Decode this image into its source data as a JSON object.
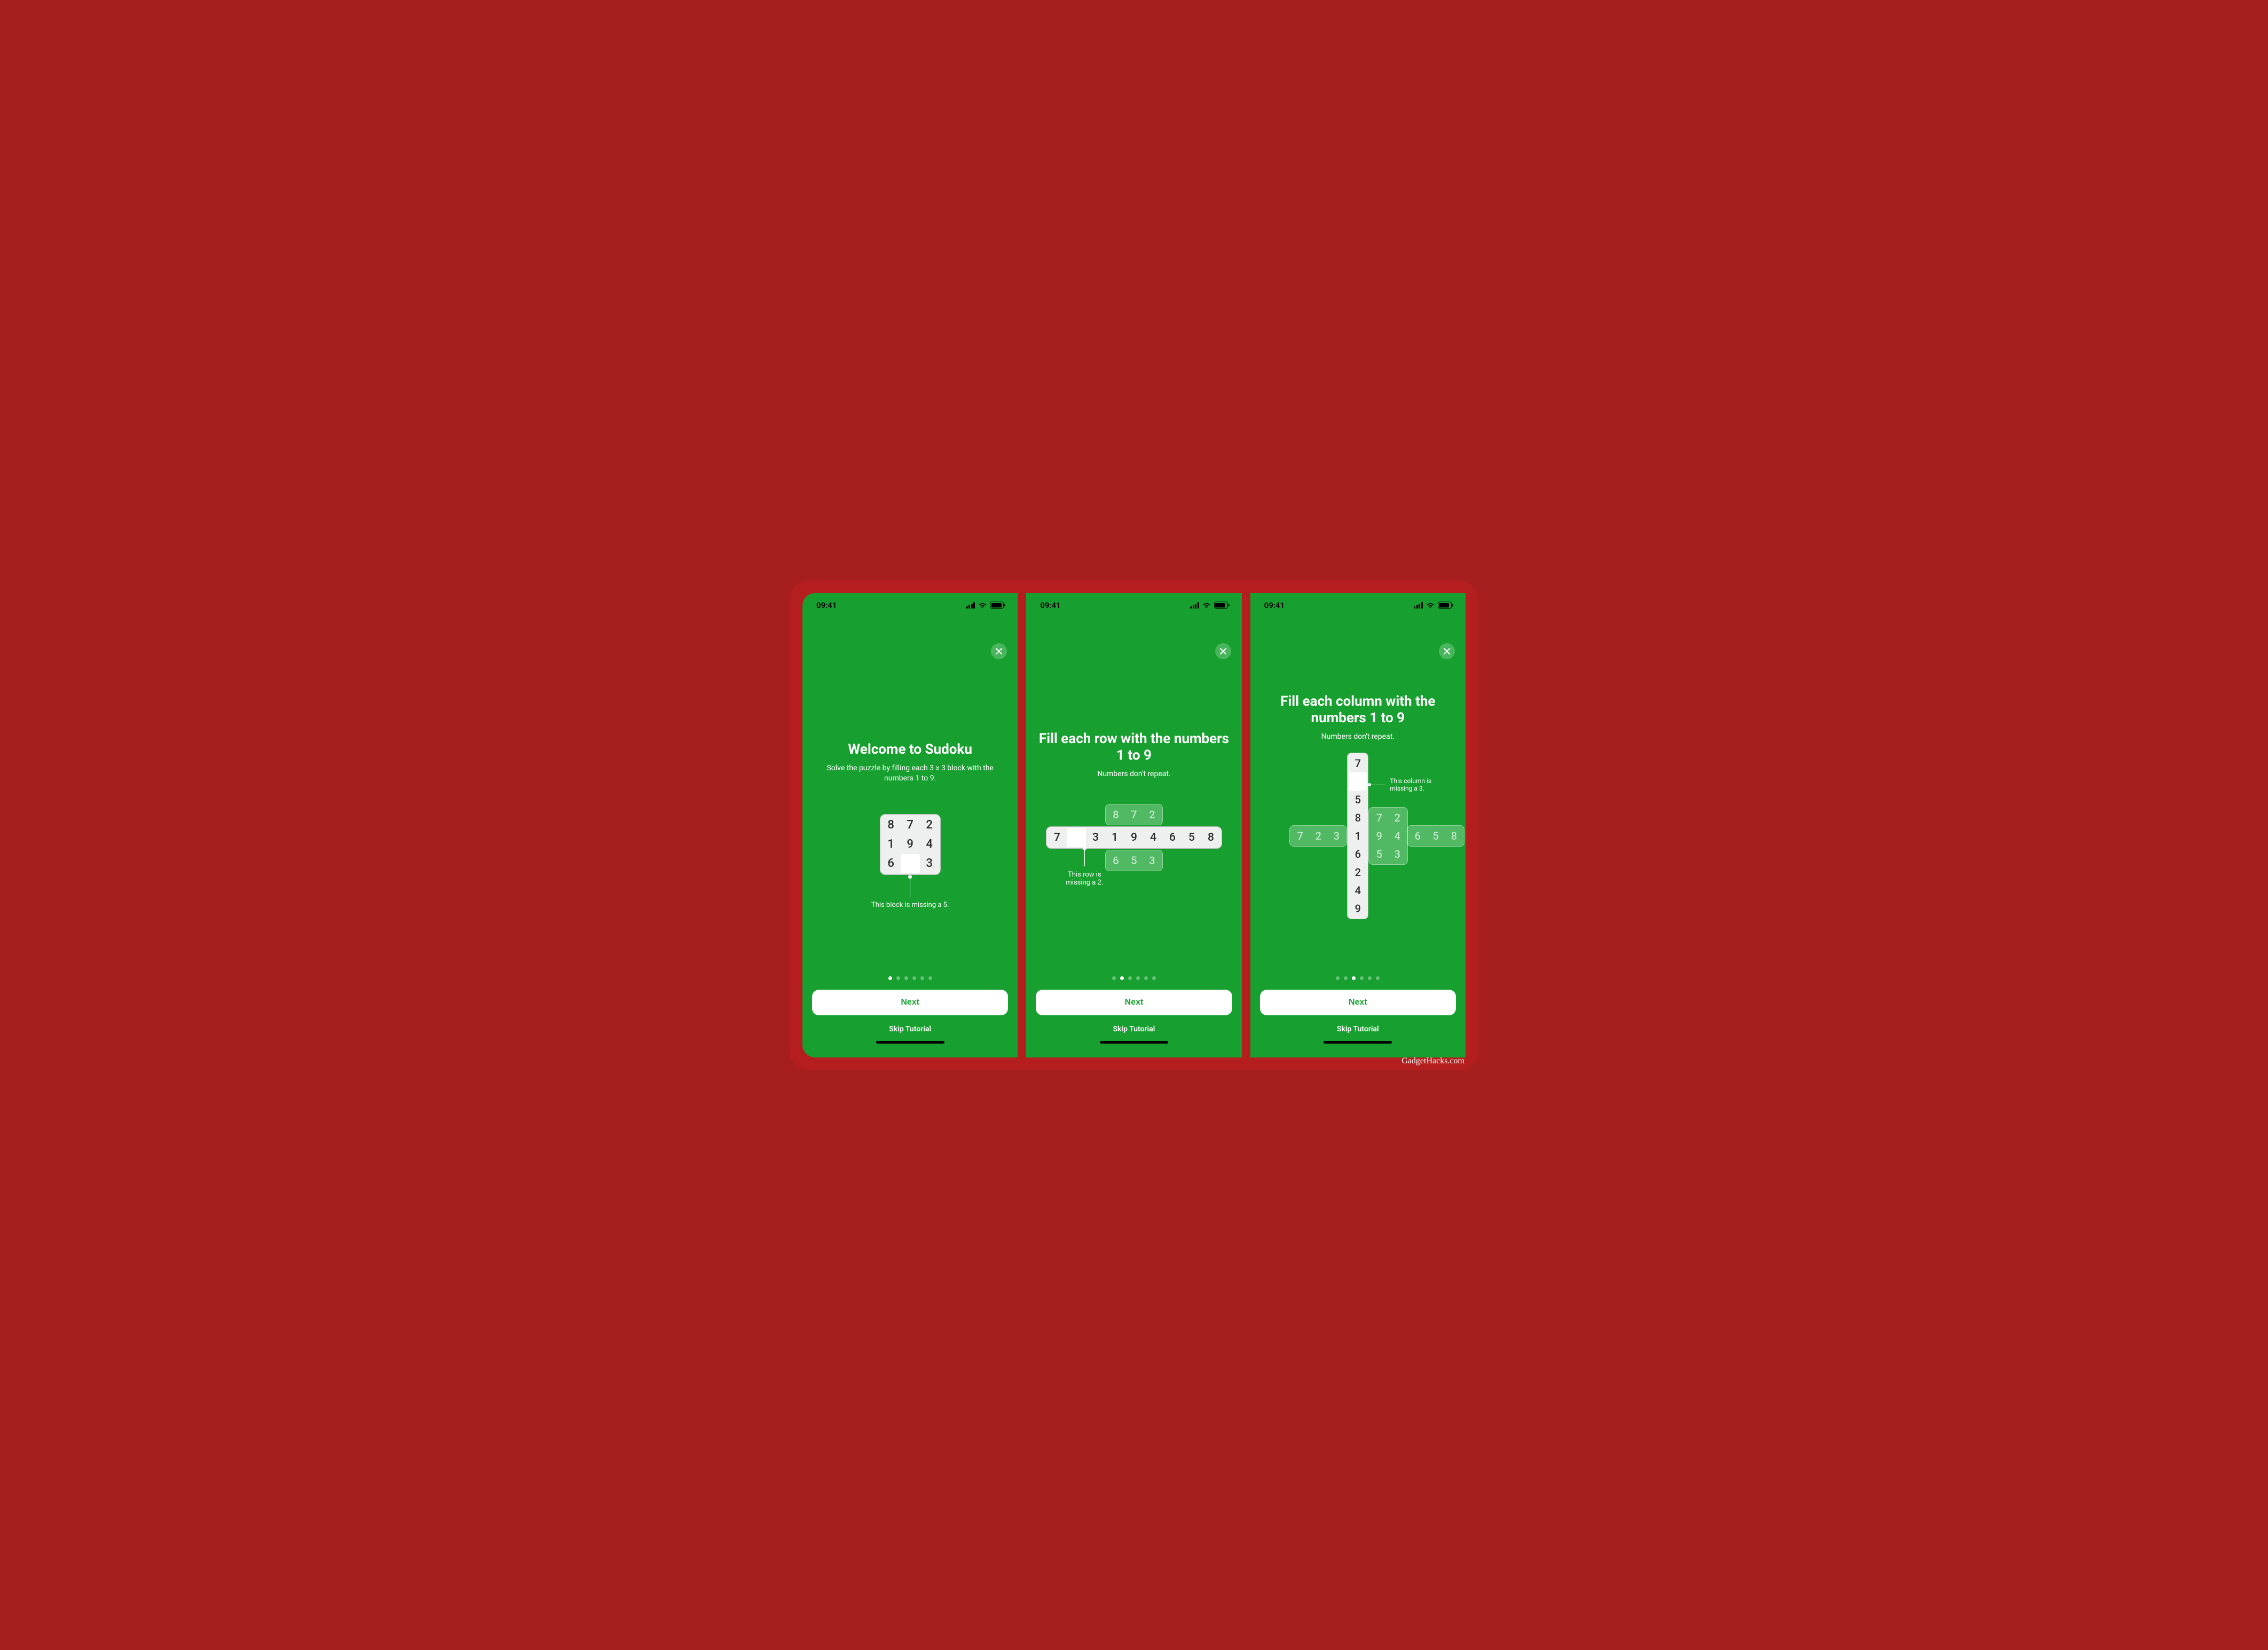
{
  "watermark": "GadgetHacks.com",
  "status_time": "09:41",
  "common": {
    "next_label": "Next",
    "skip_label": "Skip Tutorial",
    "page_count": 6
  },
  "screens": [
    {
      "active_page": 0,
      "title": "Welcome to Sudoku",
      "subtitle": "Solve the puzzle by filling each 3 x 3 block with the numbers 1 to 9.",
      "block": [
        [
          "8",
          "7",
          "2"
        ],
        [
          "1",
          "9",
          "4"
        ],
        [
          "6",
          "",
          "3"
        ]
      ],
      "callout": "This block is missing a 5."
    },
    {
      "active_page": 1,
      "title": "Fill each row with the numbers 1 to 9",
      "subtitle": "Numbers don't repeat.",
      "ghost_top": [
        "8",
        "7",
        "2"
      ],
      "row": [
        "7",
        "",
        "3",
        "1",
        "9",
        "4",
        "6",
        "5",
        "8"
      ],
      "ghost_bottom": [
        "6",
        "5",
        "3"
      ],
      "callout": "This row is missing a 2."
    },
    {
      "active_page": 2,
      "title": "Fill each column with the numbers 1 to 9",
      "subtitle": "Numbers don't repeat.",
      "col": [
        "7",
        "",
        "5",
        "8",
        "1",
        "6",
        "2",
        "4",
        "9"
      ],
      "ghost_block_right": [
        [
          "7",
          "2"
        ],
        [
          "9",
          "4"
        ],
        [
          "5",
          "3"
        ]
      ],
      "ghost_row_left": [
        "7",
        "2",
        "3"
      ],
      "ghost_row_right": [
        "6",
        "5",
        "8"
      ],
      "callout": "This column is missing a 3."
    }
  ]
}
